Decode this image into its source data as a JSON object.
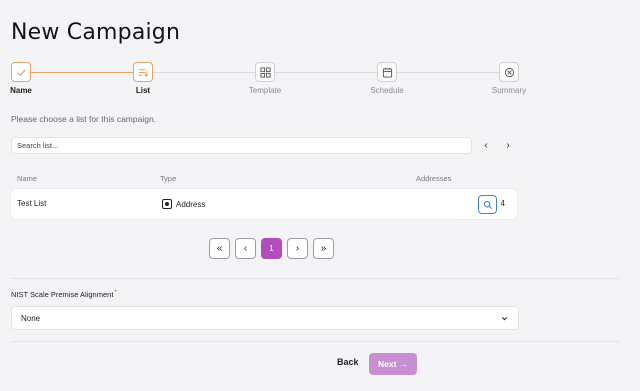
{
  "page": {
    "title": "New Campaign"
  },
  "stepper": {
    "steps": [
      {
        "label": "Name",
        "icon": "check-icon",
        "state": "done"
      },
      {
        "label": "List",
        "icon": "list-icon",
        "state": "active"
      },
      {
        "label": "Template",
        "icon": "template-icon",
        "state": "pending"
      },
      {
        "label": "Schedule",
        "icon": "calendar-icon",
        "state": "pending"
      },
      {
        "label": "Summary",
        "icon": "summary-icon",
        "state": "pending"
      }
    ]
  },
  "list_step": {
    "instruction": "Please choose a list for this campaign.",
    "search_placeholder": "Search list...",
    "prev_arrow": "‹",
    "next_arrow": "›"
  },
  "table": {
    "headers": {
      "name": "Name",
      "type": "Type",
      "addresses": "Addresses"
    },
    "rows": [
      {
        "name": "Test List",
        "type": "Address",
        "addresses": "4"
      }
    ]
  },
  "pagination": {
    "first": "«",
    "prev": "‹",
    "current": "1",
    "next": "›",
    "last": "»"
  },
  "nist": {
    "label": "NIST Scale Premise Alignment",
    "required_mark": "*",
    "selected": "None"
  },
  "footer": {
    "back_label": "Back",
    "next_label": "Next",
    "next_arrow": "→"
  },
  "colors": {
    "accent": "#b14dbd",
    "accent_disabled": "#c98fd2",
    "progress": "#e8a36a",
    "view_border": "#4a7fd6"
  }
}
